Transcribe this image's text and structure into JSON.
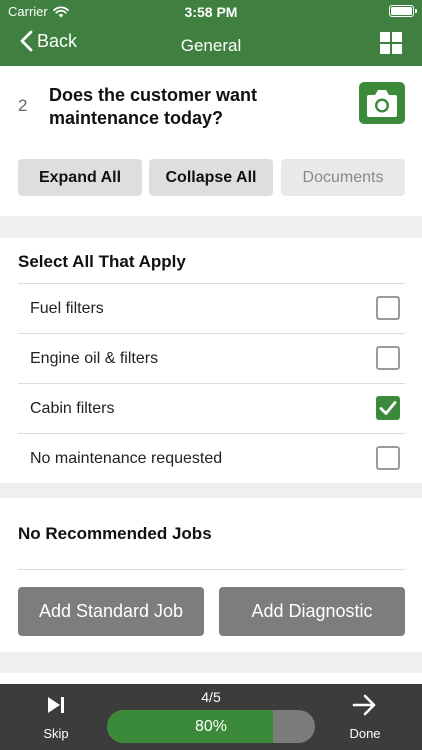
{
  "status_bar": {
    "carrier": "Carrier",
    "time": "3:58 PM"
  },
  "nav": {
    "back_label": "Back",
    "title": "General"
  },
  "question": {
    "number": "2",
    "text": "Does the customer want maintenance today?",
    "expand_all": "Expand All",
    "collapse_all": "Collapse All",
    "documents": "Documents"
  },
  "options": {
    "title": "Select All That Apply",
    "items": [
      {
        "label": "Fuel filters",
        "checked": false
      },
      {
        "label": "Engine oil & filters",
        "checked": false
      },
      {
        "label": "Cabin filters",
        "checked": true
      },
      {
        "label": "No maintenance requested",
        "checked": false
      }
    ]
  },
  "jobs": {
    "title": "No Recommended Jobs",
    "add_standard": "Add Standard Job",
    "add_diagnostic": "Add Diagnostic"
  },
  "bottom": {
    "skip_label": "Skip",
    "done_label": "Done",
    "step": "4/5",
    "progress_text": "80%",
    "progress_value": 0.8
  },
  "colors": {
    "brand_green": "#3f7f3f",
    "accent_green": "#3a8a3a",
    "dark_bar": "#3c3c3c"
  }
}
